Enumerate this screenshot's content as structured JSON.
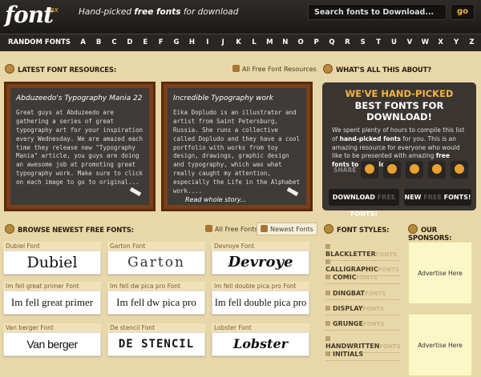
{
  "header": {
    "logo": "font",
    "logo_ex": "ex",
    "tagline_pre": "Hand-picked ",
    "tagline_bold": "free fonts",
    "tagline_post": " for download",
    "search_placeholder": "Search fonts to Download...",
    "go_label": "go"
  },
  "alphabar": {
    "random": "RANDOM FONTS",
    "letters": [
      "A",
      "B",
      "C",
      "D",
      "E",
      "F",
      "G",
      "H",
      "I",
      "J",
      "K",
      "L",
      "M",
      "N",
      "O",
      "P",
      "Q",
      "R",
      "S",
      "T",
      "U",
      "V",
      "W",
      "X",
      "Y",
      "Z"
    ]
  },
  "resources": {
    "title": "LATEST FONT RESOURCES:",
    "all_link": "All Free Font Resources",
    "posts": [
      {
        "title": "Abduzeedo's Typography Mania 22",
        "text": "Great guys at Abduzeedo are gathering a series of great typography art for your inspiration every Wednesday. We are amazed each time they release new \"Typography Mania\" article, you guys are doing an awesome job at promoting great typography work. Make sure to click on each image to go to original..."
      },
      {
        "title": "Incredible Typography work",
        "text": "Eika Dopludo is an illustrator and artist from Saint Petersburg, Russia. She runs a collective called Dopludo and they have a cool portfolio with works from toy design, drawings, graphic design and typography, which was what really caught my attention, especially the Life in the Alphabet work....",
        "read_more": "Read whole story..."
      }
    ]
  },
  "about": {
    "title": "WHAT'S ALL THIS ABOUT?",
    "h1": "WE'VE HAND-PICKED",
    "h2": "BEST FONTS FOR DOWNLOAD!",
    "p1": "We spent plenty of hours to compile this list of ",
    "p_bold1": "hand-picked fonts",
    "p2": " for you. This is an amazing resource for everyone who would like to be presented with amazing ",
    "p_bold2": "free fonts to download",
    "p3": ".",
    "share": "SHARE",
    "download_btn": "DOWNLOAD",
    "download_btn_fonts": "FONTS!",
    "new_btn": "NEW",
    "new_btn_fonts": "FONTS!"
  },
  "browse": {
    "title": "BROWSE NEWEST FREE FONTS:",
    "all_free": "All Free Fonts",
    "newest": "Newest Fonts",
    "fonts": [
      {
        "label": "Dubiel Font",
        "sample": "Dubiel"
      },
      {
        "label": "Garton Font",
        "sample": "Garton"
      },
      {
        "label": "Devroye Font",
        "sample": "Devroye"
      },
      {
        "label": "Im fell great primer Font",
        "sample": "Im fell great primer"
      },
      {
        "label": "Im fell dw pica pro Font",
        "sample": "Im fell dw pica pro"
      },
      {
        "label": "Im fell double pica pro Font",
        "sample": "Im fell double pica pro"
      },
      {
        "label": "Van berger Font",
        "sample": "Van berger"
      },
      {
        "label": "De stencil Font",
        "sample": "DE STENCIL"
      },
      {
        "label": "Lobster Font",
        "sample": "Lobster"
      }
    ]
  },
  "styles": {
    "title": "FONT STYLES:",
    "items": [
      {
        "name": "BLACKLETTER",
        "ghost": "FONTS"
      },
      {
        "name": "CALLIGRAPHIC",
        "ghost": "FONTS"
      },
      {
        "name": "COMIC",
        "ghost": "FONTS"
      },
      {
        "name": "DINGBAT",
        "ghost": "FONTS"
      },
      {
        "name": "DISPLAY",
        "ghost": "FONTS"
      },
      {
        "name": "GRUNGE",
        "ghost": "FONTS"
      },
      {
        "name": "HANDWRITTEN",
        "ghost": "FONTS"
      },
      {
        "name": "INITIALS",
        "ghost": ""
      }
    ]
  },
  "sponsors": {
    "title": "OUR SPONSORS:",
    "ad1": "Advertise Here",
    "ad2": "Advertise Here"
  },
  "colors": {
    "accent": "#f3b53a",
    "dark": "#2a2623",
    "paper": "#e8d7a8"
  }
}
